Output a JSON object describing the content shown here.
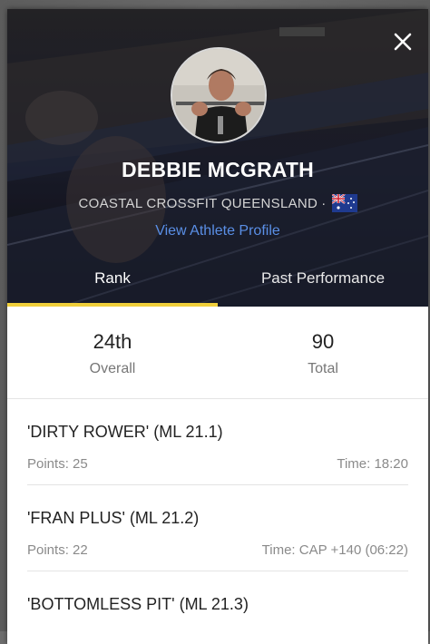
{
  "athlete": {
    "name": "DEBBIE MCGRATH",
    "affiliation": "COASTAL CROSSFIT QUEENSLAND",
    "separator": "·",
    "profile_link": "View Athlete Profile"
  },
  "tabs": [
    {
      "label": "Rank",
      "active": true
    },
    {
      "label": "Past Performance",
      "active": false
    }
  ],
  "stats": {
    "overall_value": "24th",
    "overall_label": "Overall",
    "total_value": "90",
    "total_label": "Total"
  },
  "events": [
    {
      "title": "'DIRTY ROWER' (ML 21.1)",
      "points": "Points: 25",
      "time": "Time: 18:20"
    },
    {
      "title": "'FRAN PLUS' (ML 21.2)",
      "points": "Points: 22",
      "time": "Time: CAP +140 (06:22)"
    },
    {
      "title": "'BOTTOMLESS PIT' (ML 21.3)",
      "points": "",
      "time": ""
    }
  ],
  "colors": {
    "tab_indicator": "#f0cf3a",
    "link": "#5a8fe6"
  },
  "icons": {
    "close": "close-icon",
    "flag": "australia-flag-icon"
  }
}
